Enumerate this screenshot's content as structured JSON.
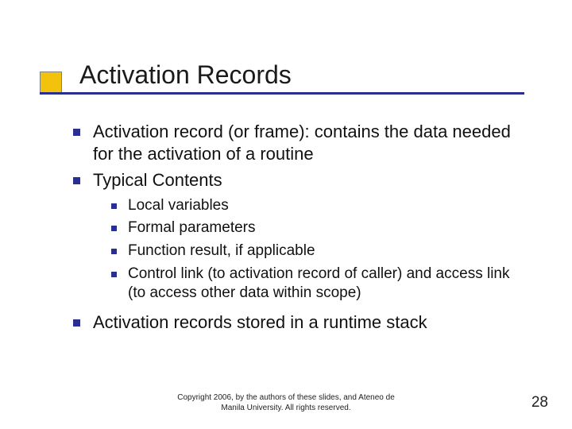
{
  "title": "Activation Records",
  "bullets": {
    "b0": "Activation record (or frame):  contains the data needed for the activation of a routine",
    "b1": "Typical Contents",
    "b2": "Activation records stored in a runtime stack"
  },
  "sub": {
    "s0": "Local variables",
    "s1": "Formal parameters",
    "s2": "Function result, if applicable",
    "s3": "Control link (to activation record of caller) and access link (to access other data within scope)"
  },
  "footer": {
    "line1": "Copyright 2006, by the authors of these slides, and Ateneo de",
    "line2": "Manila University. All rights reserved."
  },
  "page_number": "28"
}
